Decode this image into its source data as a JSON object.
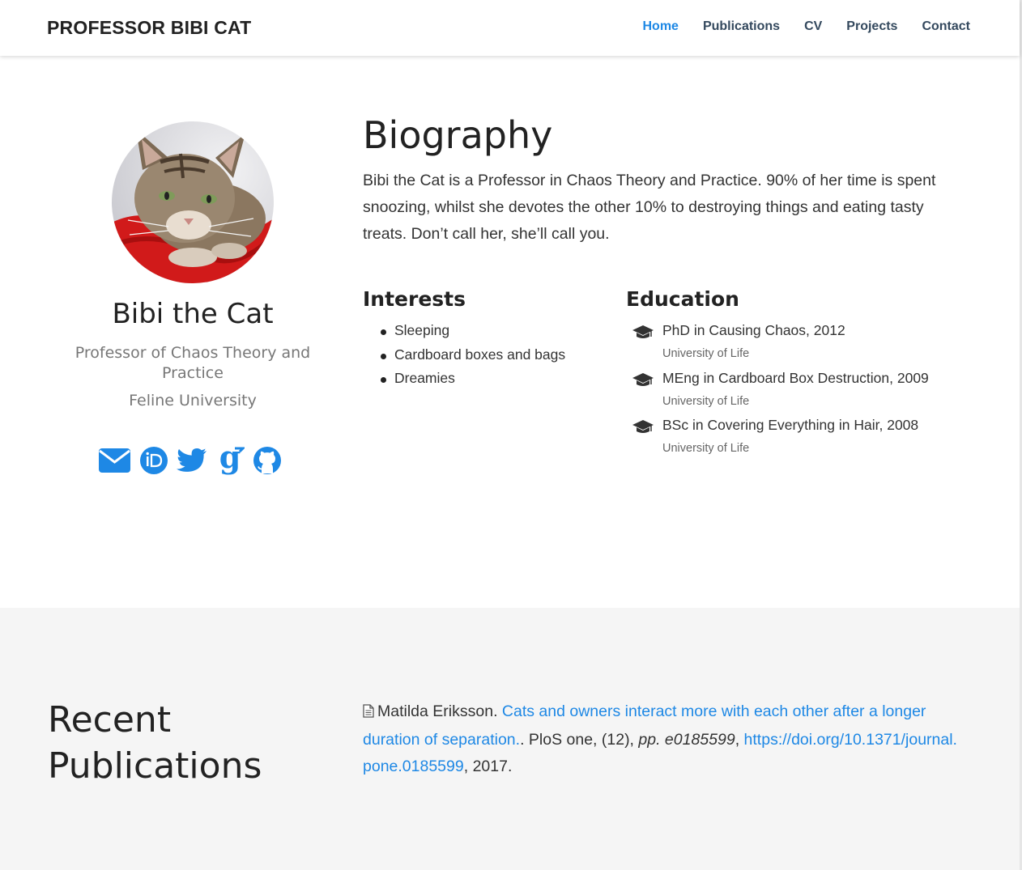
{
  "navbar": {
    "brand": "PROFESSOR BIBI CAT",
    "links": [
      "Home",
      "Publications",
      "CV",
      "Projects",
      "Contact"
    ],
    "active": "Home"
  },
  "profile": {
    "name": "Bibi the Cat",
    "role": "Professor of Chaos Theory and Practice",
    "organization": "Feline University",
    "socials": [
      "envelope-icon",
      "orcid-icon",
      "twitter-icon",
      "google-scholar-icon",
      "github-icon"
    ]
  },
  "biography": {
    "title": "Biography",
    "text": "Bibi the Cat is a Professor in Chaos Theory and Practice. 90% of her time is spent snoozing, whilst she devotes the other 10% to destroying things and eating tasty treats. Don’t call her, she’ll call you."
  },
  "interests": {
    "title": "Interests",
    "items": [
      "Sleeping",
      "Cardboard boxes and bags",
      "Dreamies"
    ]
  },
  "education": {
    "title": "Education",
    "items": [
      {
        "degree": "PhD in Causing Chaos, 2012",
        "institution": "University of Life"
      },
      {
        "degree": "MEng in Cardboard Box Destruction, 2009",
        "institution": "University of Life"
      },
      {
        "degree": "BSc in Covering Everything in Hair, 2008",
        "institution": "University of Life"
      }
    ]
  },
  "publications": {
    "title_line1": "Recent",
    "title_line2": "Publications",
    "items": [
      {
        "author": "Matilda Eriksson",
        "title": "Cats and owners interact more with each other after a longer duration of separation.",
        "journal": "PloS one, (12), ",
        "pages": "pp. e0185599",
        "doi": "https://doi.org/10.1371/journal.pone.0185599",
        "year": "2017"
      }
    ]
  },
  "colors": {
    "accent": "#1e88e5",
    "nav_text": "#34495e",
    "section_bg": "#f5f5f5"
  }
}
